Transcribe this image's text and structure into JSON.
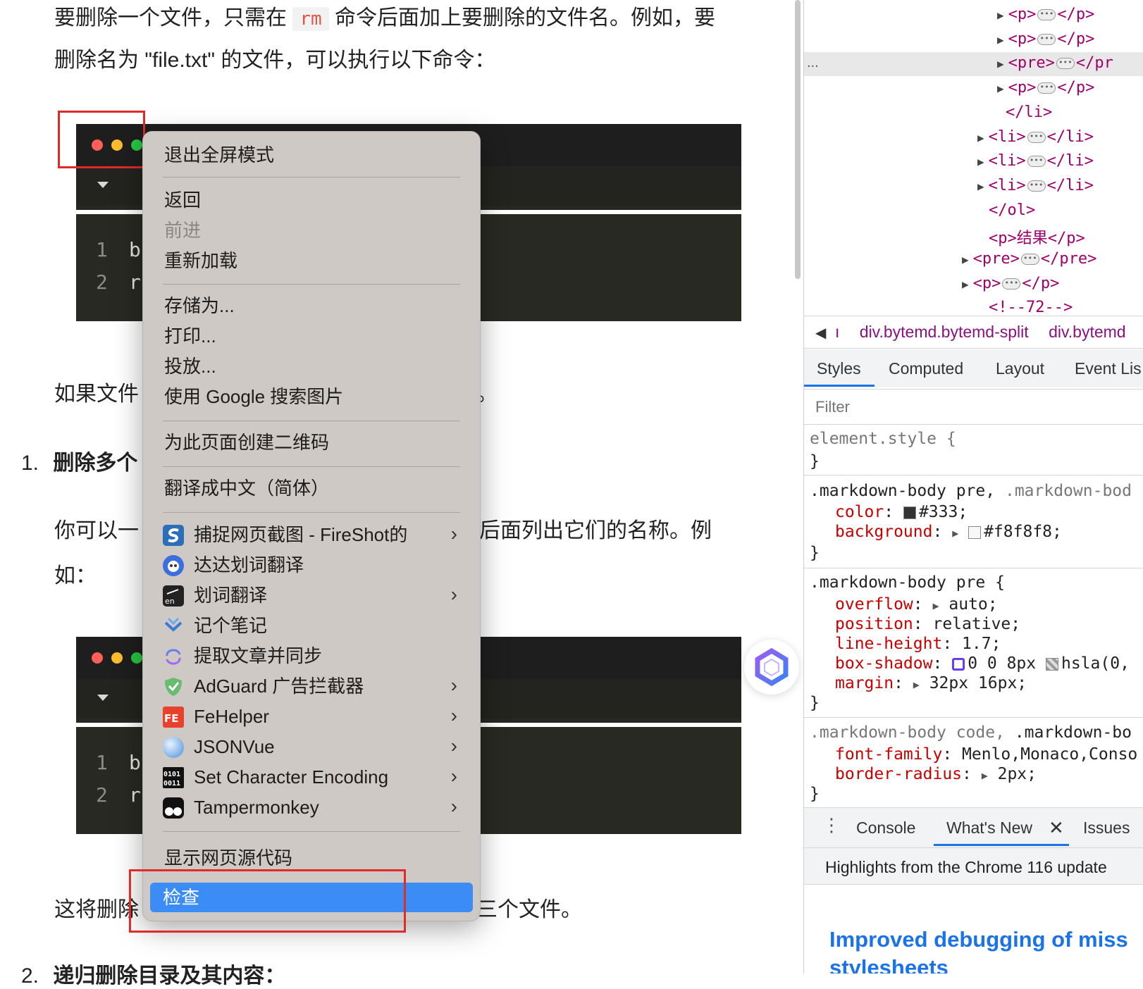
{
  "article": {
    "para1_line1_a": "要删除一个文件，只需在",
    "rm_code": "rm",
    "para1_line1_b": "命令后面加上要删除的文件名。例如，要",
    "para1_line2": "删除名为 \"file.txt\" 的文件，可以执行以下命令：",
    "code_block_1": {
      "lines": [
        {
          "num": "1",
          "text": "b"
        },
        {
          "num": "2",
          "text": "r"
        }
      ]
    },
    "para2_left": "如果文件",
    "para2_right": "。",
    "list_item_1_num": "1.",
    "list_item_1_title": "删除多个",
    "para3_left": "你可以一",
    "para3_right": "后面列出它们的名称。例",
    "para3_line2": "如：",
    "code_block_2": {
      "lines": [
        {
          "num": "1",
          "text": "b"
        },
        {
          "num": "2",
          "text": "r"
        }
      ]
    },
    "para4_left": "这将删除",
    "para4_right": "三个文件。",
    "list_item_2_num": "2.",
    "list_item_2_title": "递归删除目录及其内容："
  },
  "context_menu": {
    "exit_fullscreen": "退出全屏模式",
    "back": "返回",
    "forward": "前进",
    "reload": "重新加载",
    "save_as": "存储为...",
    "print": "打印...",
    "cast": "投放...",
    "google_image_search": "使用 Google 搜索图片",
    "qr_code": "为此页面创建二维码",
    "translate": "翻译成中文（简体）",
    "extensions": [
      {
        "label": "捕捉网页截图 - FireShot的",
        "icon": "fireshot-icon",
        "submenu": true
      },
      {
        "label": "达达划词翻译",
        "icon": "dada-translate-icon",
        "submenu": false
      },
      {
        "label": "划词翻译",
        "icon": "word-translate-icon",
        "submenu": true
      },
      {
        "label": "记个笔记",
        "icon": "note-icon",
        "submenu": false
      },
      {
        "label": "提取文章并同步",
        "icon": "sync-icon",
        "submenu": false
      },
      {
        "label": "AdGuard 广告拦截器",
        "icon": "adguard-icon",
        "submenu": true
      },
      {
        "label": "FeHelper",
        "icon": "fehelper-icon",
        "submenu": true
      },
      {
        "label": "JSONVue",
        "icon": "jsonvue-icon",
        "submenu": true
      },
      {
        "label": "Set Character Encoding",
        "icon": "encoding-icon",
        "submenu": true
      },
      {
        "label": "Tampermonkey",
        "icon": "tampermonkey-icon",
        "submenu": true
      }
    ],
    "view_source": "显示网页源代码",
    "inspect": "检查",
    "submenu_arrow": "›"
  },
  "devtools": {
    "dom_lines": [
      {
        "open": "<p>",
        "close": "</p>",
        "collapsed": true
      },
      {
        "open": "<p>",
        "close": "</p>",
        "collapsed": true
      },
      {
        "open": "<pre>",
        "close": "</pr",
        "collapsed": true
      },
      {
        "open": "<p>",
        "close": "</p>",
        "collapsed": true
      },
      {
        "open": "</li>",
        "close": "",
        "collapsed": false
      },
      {
        "open": "<li>",
        "close": "</li>",
        "collapsed": true
      },
      {
        "open": "<li>",
        "close": "</li>",
        "collapsed": true
      },
      {
        "open": "<li>",
        "close": "</li>",
        "collapsed": true
      },
      {
        "open": "</ol>",
        "close": "",
        "collapsed": false
      },
      {
        "open": "<p>结果</p>",
        "close": "",
        "collapsed": false
      },
      {
        "open": "<pre>",
        "close": "</pre>",
        "collapsed": true
      },
      {
        "open": "<p>",
        "close": "</p>",
        "collapsed": true
      },
      {
        "open": "<!--72-->",
        "close": "",
        "collapsed": false
      }
    ],
    "dom_ellipsis": "...",
    "breadcrumb_1": "div.bytemd.bytemd-split",
    "breadcrumb_2": "div.bytemd",
    "breadcrumb_cut": "ı",
    "tabs": {
      "styles": "Styles",
      "computed": "Computed",
      "layout": "Layout",
      "event_listeners": "Event Lis"
    },
    "filter_placeholder": "Filter",
    "rules": {
      "element_style": "element.style {",
      "close": "}",
      "r1_sel_a": ".markdown-body pre,",
      "r1_sel_b": ".markdown-bod",
      "r1_color_prop": "color",
      "r1_color_val": "#333;",
      "r1_bg_prop": "background",
      "r1_bg_val": "#f8f8f8;",
      "r2_sel": ".markdown-body pre {",
      "r2_overflow": "overflow",
      "r2_overflow_val": "auto;",
      "r2_position": "position",
      "r2_position_val": "relative;",
      "r2_lh": "line-height",
      "r2_lh_val": "1.7;",
      "r2_bs": "box-shadow",
      "r2_bs_val_a": "0 0 8px",
      "r2_bs_val_b": "hsla(0,",
      "r2_margin": "margin",
      "r2_margin_val": "32px 16px;",
      "r3_sel_a": ".markdown-body code,",
      "r3_sel_b": ".markdown-bo",
      "r3_ff": "font-family",
      "r3_ff_val": "Menlo,Monaco,Conso",
      "r3_br": "border-radius",
      "r3_br_val": "2px;"
    },
    "drawer_tabs": {
      "console": "Console",
      "whats_new": "What's New",
      "issues": "Issues"
    },
    "whats_new_heading": "Highlights from the Chrome 116 update",
    "whats_new_title_1": "Improved debugging of miss",
    "whats_new_title_2": "stylesheets"
  },
  "colors": {
    "highlight": "#3b8df5",
    "red_box": "#e02b2b",
    "code_bg": "#272822"
  }
}
